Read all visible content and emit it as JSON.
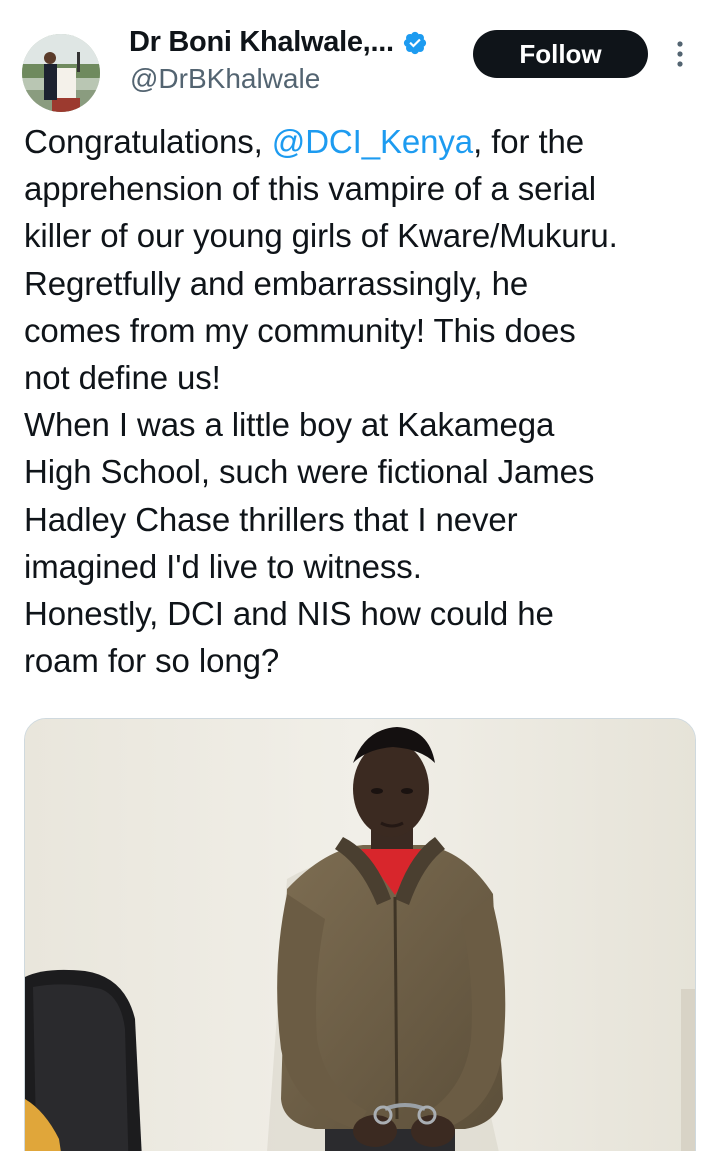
{
  "author": {
    "display_name": "Dr Boni Khalwale,...",
    "handle": "@DrBKhalwale",
    "verified": true,
    "avatar_icon": "profile-photo"
  },
  "actions": {
    "follow_label": "Follow",
    "more_icon": "more-vertical-icon"
  },
  "tweet": {
    "lines": [
      {
        "pre": "Congratulations, ",
        "mention": "@DCI_Kenya",
        "post": ", for the"
      },
      {
        "text": "apprehension of this vampire of a serial"
      },
      {
        "text": "killer of our young girls of Kware/Mukuru."
      },
      {
        "text": "Regretfully and embarrassingly, he"
      },
      {
        "text": "comes from my community! This does"
      },
      {
        "text": "not define us!"
      },
      {
        "text": "When I was a little boy at Kakamega"
      },
      {
        "text": "High School, such were fictional James"
      },
      {
        "text": "Hadley Chase thrillers that I never"
      },
      {
        "text": "imagined I'd live to witness."
      },
      {
        "text": "Honestly, DCI and NIS how could he"
      },
      {
        "text": "roam for so long?"
      }
    ]
  },
  "media": {
    "type": "photo"
  },
  "colors": {
    "mention": "#1d9bf0",
    "verified": "#1d9bf0",
    "text": "#0f1419",
    "secondary": "#536471",
    "follow_bg": "#0f1419"
  }
}
